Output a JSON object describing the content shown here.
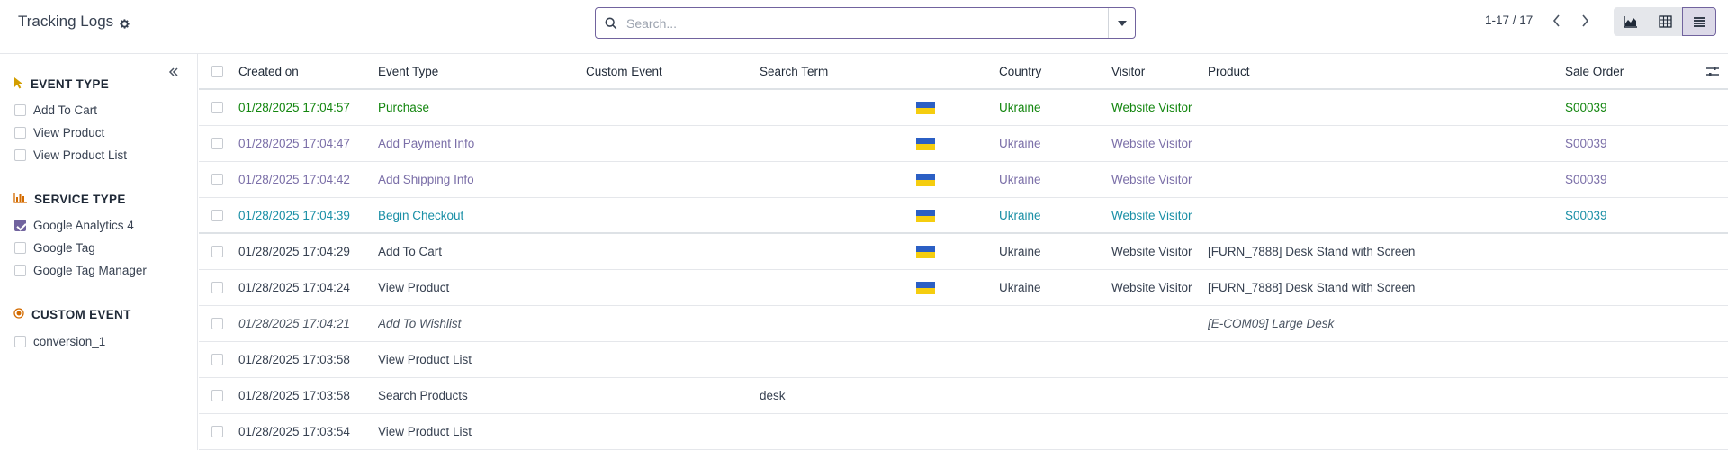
{
  "header": {
    "title": "Tracking Logs",
    "search_placeholder": "Search...",
    "pager": "1-17 / 17"
  },
  "sidebar": {
    "sections": [
      {
        "title": "EVENT TYPE",
        "items": [
          "Add To Cart",
          "View Product",
          "View Product List"
        ]
      },
      {
        "title": "SERVICE TYPE",
        "items": [
          "Google Analytics 4",
          "Google Tag",
          "Google Tag Manager"
        ],
        "checked": [
          true,
          false,
          false
        ]
      },
      {
        "title": "CUSTOM EVENT",
        "items": [
          "conversion_1"
        ]
      }
    ]
  },
  "table": {
    "columns": [
      "Created on",
      "Event Type",
      "Custom Event",
      "Search Term",
      "Country",
      "Visitor",
      "Product",
      "Sale Order"
    ],
    "rows": [
      {
        "created": "01/28/2025 17:04:57",
        "event": "Purchase",
        "custom": "",
        "term": "",
        "flag": true,
        "country": "Ukraine",
        "visitor": "Website Visitor",
        "product": "",
        "order": "S00039",
        "style": "success"
      },
      {
        "created": "01/28/2025 17:04:47",
        "event": "Add Payment Info",
        "custom": "",
        "term": "",
        "flag": true,
        "country": "Ukraine",
        "visitor": "Website Visitor",
        "product": "",
        "order": "S00039",
        "style": "muted"
      },
      {
        "created": "01/28/2025 17:04:42",
        "event": "Add Shipping Info",
        "custom": "",
        "term": "",
        "flag": true,
        "country": "Ukraine",
        "visitor": "Website Visitor",
        "product": "",
        "order": "S00039",
        "style": "muted"
      },
      {
        "created": "01/28/2025 17:04:39",
        "event": "Begin Checkout",
        "custom": "",
        "term": "",
        "flag": true,
        "country": "Ukraine",
        "visitor": "Website Visitor",
        "product": "",
        "order": "S00039",
        "style": "info"
      },
      {
        "created": "01/28/2025 17:04:29",
        "event": "Add To Cart",
        "custom": "",
        "term": "",
        "flag": true,
        "country": "Ukraine",
        "visitor": "Website Visitor",
        "product": "[FURN_7888] Desk Stand with Screen",
        "order": "",
        "style": "normal"
      },
      {
        "created": "01/28/2025 17:04:24",
        "event": "View Product",
        "custom": "",
        "term": "",
        "flag": true,
        "country": "Ukraine",
        "visitor": "Website Visitor",
        "product": "[FURN_7888] Desk Stand with Screen",
        "order": "",
        "style": "normal"
      },
      {
        "created": "01/28/2025 17:04:21",
        "event": "Add To Wishlist",
        "custom": "",
        "term": "",
        "flag": false,
        "country": "",
        "visitor": "",
        "product": "[E-COM09] Large Desk",
        "order": "",
        "style": "italic"
      },
      {
        "created": "01/28/2025 17:03:58",
        "event": "View Product List",
        "custom": "",
        "term": "",
        "flag": false,
        "country": "",
        "visitor": "",
        "product": "",
        "order": "",
        "style": "normal"
      },
      {
        "created": "01/28/2025 17:03:58",
        "event": "Search Products",
        "custom": "",
        "term": "desk",
        "flag": false,
        "country": "",
        "visitor": "",
        "product": "",
        "order": "",
        "style": "normal"
      },
      {
        "created": "01/28/2025 17:03:54",
        "event": "View Product List",
        "custom": "",
        "term": "",
        "flag": false,
        "country": "",
        "visitor": "",
        "product": "",
        "order": "",
        "style": "normal"
      }
    ]
  },
  "colors": {
    "accent": "#71639e",
    "success": "#13860f",
    "muted": "#7b6fa8",
    "info": "#1a8fa6",
    "flag_blue": "#2b5fc4",
    "flag_yellow": "#f5cd0f"
  }
}
